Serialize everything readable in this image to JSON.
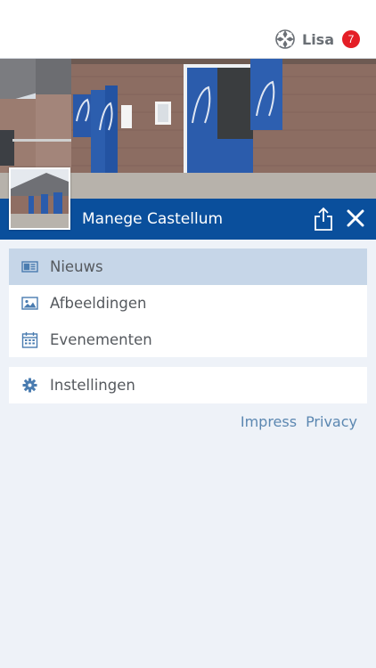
{
  "header": {
    "user_name": "Lisa",
    "notification_count": "7",
    "logo_icon": "fourleaf-logo-icon"
  },
  "hero": {
    "title": "Manege Castellum",
    "share_icon": "share-icon",
    "close_icon": "close-icon"
  },
  "menu": {
    "group1": [
      {
        "label": "Nieuws",
        "icon": "newspaper-icon",
        "active": true
      },
      {
        "label": "Afbeeldingen",
        "icon": "image-icon",
        "active": false
      },
      {
        "label": "Evenementen",
        "icon": "calendar-icon",
        "active": false
      }
    ],
    "group2": [
      {
        "label": "Instellingen",
        "icon": "gear-icon",
        "active": false
      }
    ]
  },
  "footer_links": {
    "impress": "Impress",
    "privacy": "Privacy"
  },
  "colors": {
    "brand_blue": "#0a4f9c",
    "active_row": "#c6d6e8",
    "icon_blue": "#4a7cb0",
    "badge_red": "#e41e26",
    "link_blue": "#5b87b1",
    "background": "#eef2f8"
  }
}
